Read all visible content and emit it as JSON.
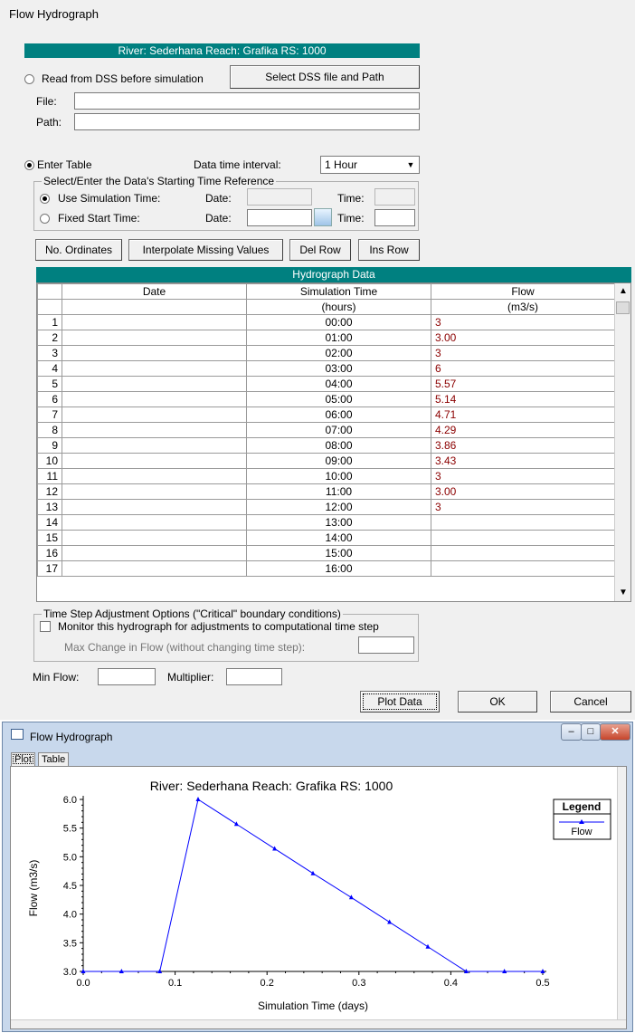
{
  "dialog": {
    "title": "Flow Hydrograph",
    "header": "River: Sederhana  Reach: Grafika  RS: 1000",
    "read_dss_label": "Read from DSS before simulation",
    "select_dss_button": "Select DSS file and Path",
    "file_label": "File:",
    "path_label": "Path:",
    "enter_table_label": "Enter Table",
    "interval_label": "Data time interval:",
    "interval_value": "1 Hour",
    "time_ref_group": "Select/Enter the Data's Starting Time Reference",
    "use_sim_time": "Use Simulation Time:",
    "fixed_start": "Fixed Start Time:",
    "date_label": "Date:",
    "time_label": "Time:",
    "buttons": {
      "no_ordinates": "No. Ordinates",
      "interpolate": "Interpolate Missing Values",
      "del_row": "Del Row",
      "ins_row": "Ins Row"
    },
    "grid_title": "Hydrograph Data",
    "columns": [
      "Date",
      "Simulation Time",
      "Flow"
    ],
    "units": [
      "",
      "(hours)",
      "(m3/s)"
    ],
    "rows": [
      {
        "n": "1",
        "date": "",
        "time": "00:00",
        "flow": "3"
      },
      {
        "n": "2",
        "date": "",
        "time": "01:00",
        "flow": "3.00"
      },
      {
        "n": "3",
        "date": "",
        "time": "02:00",
        "flow": "3"
      },
      {
        "n": "4",
        "date": "",
        "time": "03:00",
        "flow": "6"
      },
      {
        "n": "5",
        "date": "",
        "time": "04:00",
        "flow": "5.57"
      },
      {
        "n": "6",
        "date": "",
        "time": "05:00",
        "flow": "5.14"
      },
      {
        "n": "7",
        "date": "",
        "time": "06:00",
        "flow": "4.71"
      },
      {
        "n": "8",
        "date": "",
        "time": "07:00",
        "flow": "4.29"
      },
      {
        "n": "9",
        "date": "",
        "time": "08:00",
        "flow": "3.86"
      },
      {
        "n": "10",
        "date": "",
        "time": "09:00",
        "flow": "3.43"
      },
      {
        "n": "11",
        "date": "",
        "time": "10:00",
        "flow": "3"
      },
      {
        "n": "12",
        "date": "",
        "time": "11:00",
        "flow": "3.00"
      },
      {
        "n": "13",
        "date": "",
        "time": "12:00",
        "flow": "3"
      },
      {
        "n": "14",
        "date": "",
        "time": "13:00",
        "flow": ""
      },
      {
        "n": "15",
        "date": "",
        "time": "14:00",
        "flow": ""
      },
      {
        "n": "16",
        "date": "",
        "time": "15:00",
        "flow": ""
      },
      {
        "n": "17",
        "date": "",
        "time": "16:00",
        "flow": ""
      }
    ],
    "tsa_group": "Time Step Adjustment Options (\"Critical\" boundary conditions)",
    "monitor_label": "Monitor this hydrograph for adjustments to computational time step",
    "max_change_label": "Max Change in Flow (without changing time step):",
    "min_flow_label": "Min Flow:",
    "multiplier_label": "Multiplier:",
    "plot_data": "Plot Data",
    "ok": "OK",
    "cancel": "Cancel"
  },
  "plot_window": {
    "title": "Flow Hydrograph",
    "tab_plot": "Plot",
    "tab_table": "Table",
    "legend_title": "Legend",
    "legend_item": "Flow",
    "line_color": "#0000ff"
  },
  "chart_data": {
    "type": "line",
    "title": "River: Sederhana  Reach: Grafika  RS: 1000",
    "xlabel": "Simulation Time (days)",
    "ylabel": "Flow  (m3/s)",
    "xlim": [
      0,
      0.5
    ],
    "ylim": [
      3.0,
      6.0
    ],
    "xticks": [
      "0.0",
      "0.1",
      "0.2",
      "0.3",
      "0.4",
      "0.5"
    ],
    "yticks": [
      "3.0",
      "3.5",
      "4.0",
      "4.5",
      "5.0",
      "5.5",
      "6.0"
    ],
    "legend": "top-right",
    "series": [
      {
        "name": "Flow",
        "x": [
          0,
          0.0417,
          0.0833,
          0.125,
          0.1667,
          0.2083,
          0.25,
          0.2917,
          0.3333,
          0.375,
          0.4167,
          0.4583,
          0.5
        ],
        "y": [
          3,
          3,
          3,
          6,
          5.57,
          5.14,
          4.71,
          4.29,
          3.86,
          3.43,
          3,
          3,
          3
        ]
      }
    ]
  }
}
